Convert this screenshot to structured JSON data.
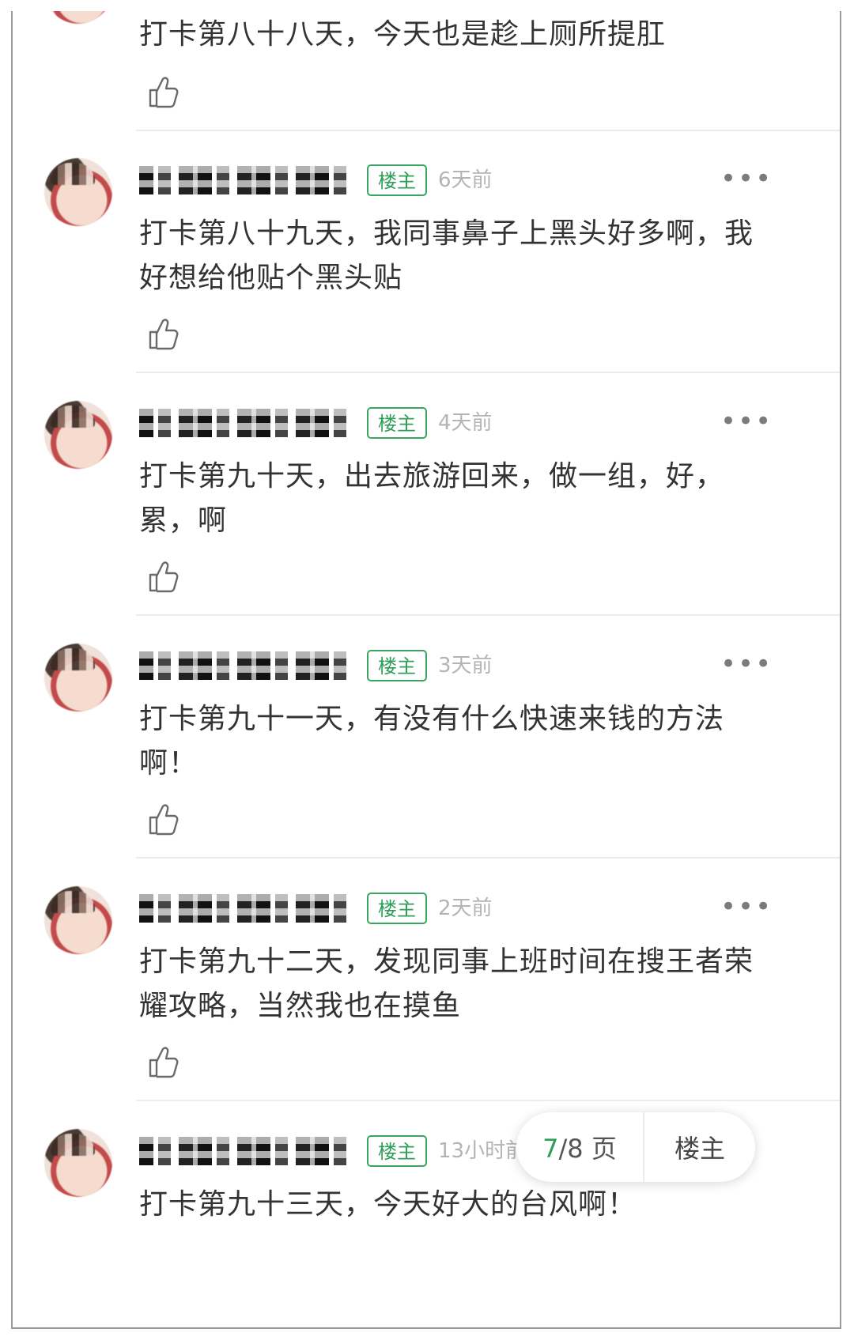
{
  "posts": [
    {
      "text": "打卡第八十八天，今天也是趁上厕所提肛",
      "badge": "",
      "time": ""
    },
    {
      "text": "打卡第八十九天，我同事鼻子上黑头好多啊，我好想给他贴个黑头贴",
      "badge": "楼主",
      "time": "6天前"
    },
    {
      "text": "打卡第九十天，出去旅游回来，做一组，好，累，啊",
      "badge": "楼主",
      "time": "4天前"
    },
    {
      "text": "打卡第九十一天，有没有什么快速来钱的方法啊！",
      "badge": "楼主",
      "time": "3天前"
    },
    {
      "text": "打卡第九十二天，发现同事上班时间在搜王者荣耀攻略，当然我也在摸鱼",
      "badge": "楼主",
      "time": "2天前"
    },
    {
      "text": "打卡第九十三天，今天好大的台风啊！",
      "badge": "楼主",
      "time": "13小时前"
    }
  ],
  "more_label": "•••",
  "pager": {
    "current": "7",
    "total_text": "/8 页",
    "owner_label": "楼主"
  },
  "icons": {
    "like": "thumbs-up-icon",
    "more": "more-dots-icon"
  },
  "colors": {
    "accent": "#2f9e57",
    "text": "#333333",
    "muted": "#b4b4b4"
  }
}
